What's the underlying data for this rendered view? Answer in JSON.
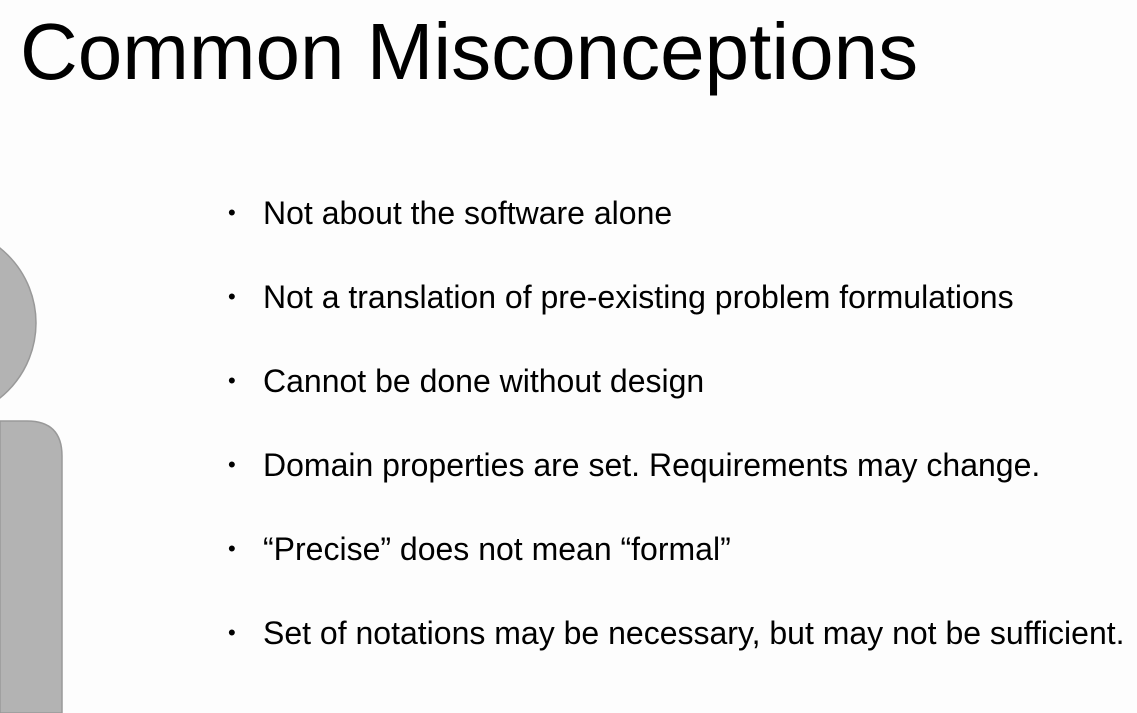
{
  "title": "Common Misconceptions",
  "bullets": [
    "Not about the software alone",
    "Not a translation of pre-existing problem formulations",
    "Cannot be done without design",
    "Domain properties are set. Requirements may change.",
    "“Precise” does not mean “formal”",
    "Set of notations may be necessary, but may not be sufficient."
  ],
  "bullet_glyph": "•",
  "colors": {
    "figure_fill": "#b3b3b3",
    "figure_stroke": "#999999"
  }
}
